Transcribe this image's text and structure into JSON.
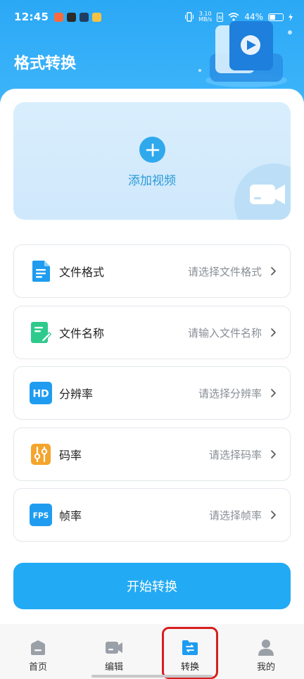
{
  "status_bar": {
    "time": "12:45",
    "net_speed_value": "3.10",
    "net_speed_unit": "MB/s",
    "battery": "44%"
  },
  "header": {
    "title": "格式转换"
  },
  "add_video": {
    "label": "添加视频"
  },
  "options": [
    {
      "label": "文件格式",
      "value": "请选择文件格式",
      "icon": "document-icon"
    },
    {
      "label": "文件名称",
      "value": "请输入文件名称",
      "icon": "edit-document-icon"
    },
    {
      "label": "分辨率",
      "value": "请选择分辨率",
      "icon": "hd-icon",
      "icon_text": "HD"
    },
    {
      "label": "码率",
      "value": "请选择码率",
      "icon": "sliders-icon"
    },
    {
      "label": "帧率",
      "value": "请选择帧率",
      "icon": "fps-icon",
      "icon_text": "FPS"
    }
  ],
  "start_button": {
    "label": "开始转换"
  },
  "bottom_nav": {
    "items": [
      {
        "label": "首页",
        "icon": "home-icon"
      },
      {
        "label": "编辑",
        "icon": "video-camera-icon"
      },
      {
        "label": "转换",
        "icon": "convert-folder-icon",
        "active": true
      },
      {
        "label": "我的",
        "icon": "user-icon"
      }
    ]
  },
  "colors": {
    "brand": "#23aaf4",
    "header": "#2ba8f5",
    "highlight": "#d81f1f"
  }
}
